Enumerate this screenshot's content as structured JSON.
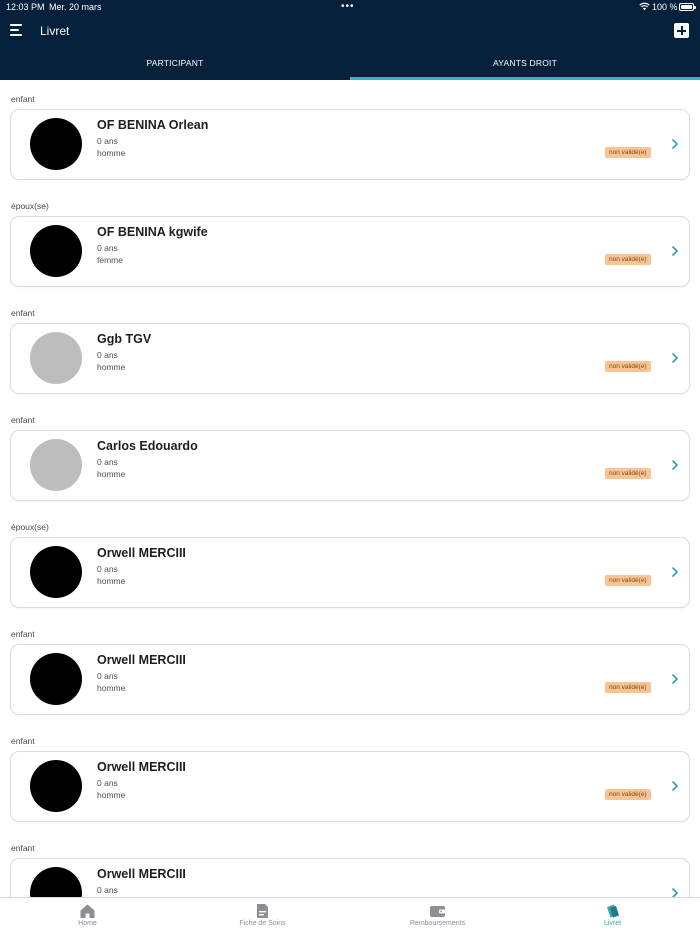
{
  "status_bar": {
    "time": "12:03 PM",
    "date": "Mer. 20 mars",
    "battery": "100 %"
  },
  "header": {
    "title": "Livret"
  },
  "tabs": [
    {
      "label": "PARTICIPANT"
    },
    {
      "label": "AYANTS DROIT"
    }
  ],
  "beneficiaries": [
    {
      "relation": "enfant",
      "name": "OF BENINA Orlean",
      "age": "0 ans",
      "gender": "homme",
      "status": "non validé(e)"
    },
    {
      "relation": "époux(se)",
      "name": "OF BENINA kgwife",
      "age": "0 ans",
      "gender": "femme",
      "status": "non validé(e)"
    },
    {
      "relation": "enfant",
      "name": "Ggb TGV",
      "age": "0 ans",
      "gender": "homme",
      "status": "non validé(e)"
    },
    {
      "relation": "enfant",
      "name": "Carlos Edouardo",
      "age": "0 ans",
      "gender": "homme",
      "status": "non validé(e)"
    },
    {
      "relation": "époux(se)",
      "name": "Orwell MERCIII",
      "age": "0 ans",
      "gender": "homme",
      "status": "non validé(e)"
    },
    {
      "relation": "enfant",
      "name": "Orwell MERCIII",
      "age": "0 ans",
      "gender": "homme",
      "status": "non validé(e)"
    },
    {
      "relation": "enfant",
      "name": "Orwell MERCIII",
      "age": "0 ans",
      "gender": "homme",
      "status": "non validé(e)"
    },
    {
      "relation": "enfant",
      "name": "Orwell MERCIII",
      "age": "0 ans",
      "gender": "",
      "status": ""
    }
  ],
  "bottom_nav": [
    {
      "label": "Home",
      "icon": "home-icon"
    },
    {
      "label": "Fiche de Soins",
      "icon": "document-icon"
    },
    {
      "label": "Remboursements",
      "icon": "wallet-icon"
    },
    {
      "label": "Livret",
      "icon": "booklet-icon"
    }
  ],
  "colors": {
    "header_bg": "#04203a",
    "tab_indicator": "#36b6c1",
    "badge_bg": "#f8c493",
    "chevron": "#2a9fb0",
    "avatar_dark": "#000000",
    "avatar_placeholder": "#bdbdbd"
  }
}
